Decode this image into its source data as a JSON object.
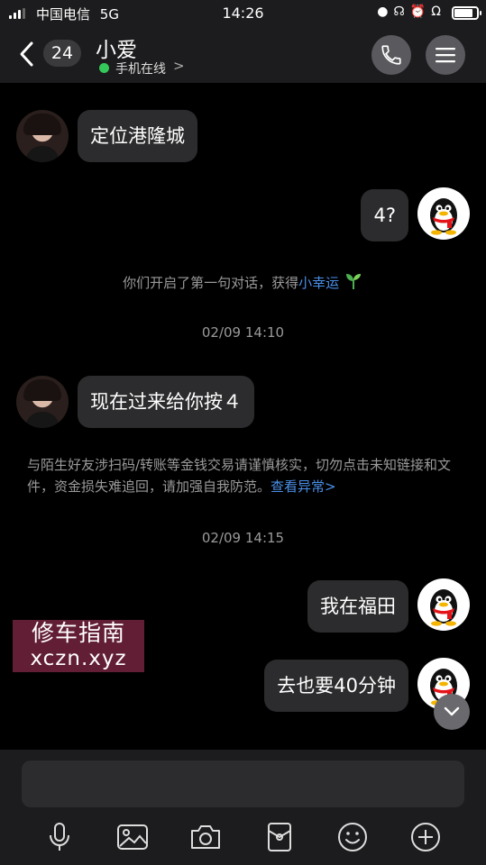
{
  "status_bar": {
    "carrier": "中国电信",
    "network": "5G",
    "time": "14:26",
    "battery_level": 0.85
  },
  "header": {
    "unread_count": "24",
    "contact_name": "小爱",
    "online_status": "手机在线",
    "online_chevron": ">"
  },
  "messages": {
    "m1": "定位港隆城",
    "m2": "4?",
    "system_prefix": "你们开启了第一句对话，获得",
    "system_link": "小幸运",
    "time1": "02/09 14:10",
    "m3": "现在过来给你按４",
    "warning_text": "与陌生好友涉扫码/转账等金钱交易请谨慎核实，切勿点击未知链接和文件，资金损失难追回，请加强自我防范。",
    "warning_link": "查看异常>",
    "time2": "02/09 14:15",
    "m4": "我在福田",
    "m5": "去也要40分钟"
  },
  "watermark": {
    "line1": "修车指南",
    "line2": "xczn.xyz"
  },
  "input": {
    "value": "",
    "placeholder": ""
  },
  "colors": {
    "bubble": "#2c2c2e",
    "link": "#4a8fe7",
    "online": "#34c759",
    "background": "#000000"
  },
  "icons": {
    "back": "chevron-left-icon",
    "call": "phone-icon",
    "menu": "hamburger-menu-icon",
    "scroll": "chevron-down-icon",
    "toolbar": [
      "microphone-icon",
      "image-icon",
      "camera-icon",
      "red-packet-icon",
      "emoji-icon",
      "plus-icon"
    ]
  }
}
